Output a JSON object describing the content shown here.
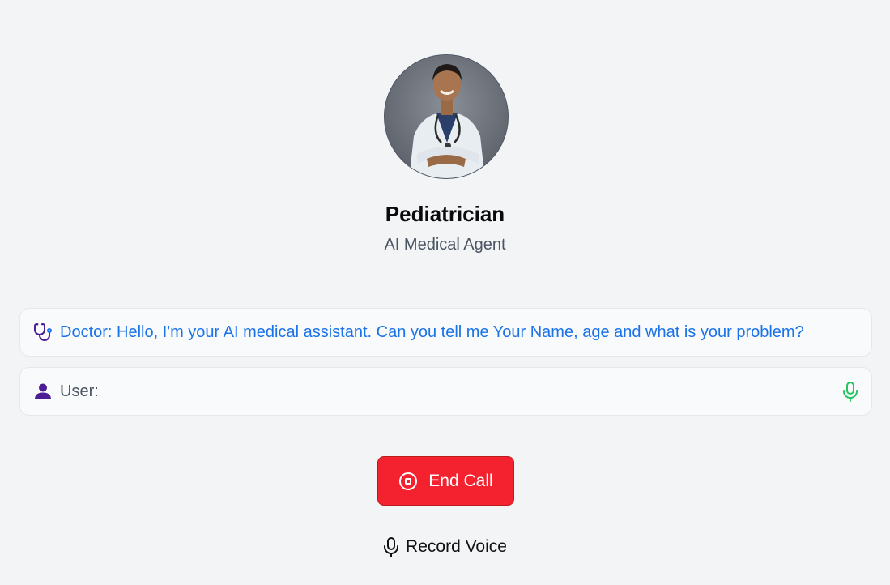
{
  "agent": {
    "name": "Pediatrician",
    "role": "AI Medical Agent"
  },
  "conversation": {
    "doctor_message": "Doctor: Hello, I'm your AI medical assistant. Can you tell me Your Name, age and what is your problem?",
    "user_label": "User:"
  },
  "controls": {
    "end_call_label": "End Call",
    "record_voice_label": "Record Voice"
  },
  "colors": {
    "end_call_bg": "#f4222f",
    "doctor_text": "#1a73e8",
    "mic_active": "#22c55e",
    "icon_purple": "#4c1d95"
  },
  "icons": {
    "doctor": "stethoscope-icon",
    "user": "user-icon",
    "mic_status": "microphone-icon",
    "end_call": "stop-circle-icon",
    "record": "microphone-icon"
  }
}
